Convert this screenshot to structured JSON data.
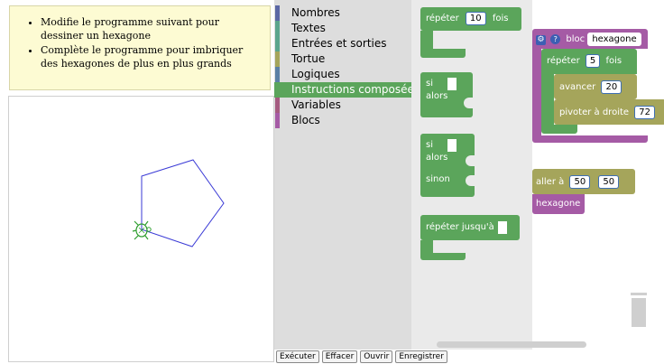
{
  "instructions": {
    "items": [
      "Modifie le programme suivant pour dessiner un hexagone",
      "Complète le programme pour imbriquer des hexagones de plus en plus grands"
    ]
  },
  "categories": [
    {
      "label": "Nombres",
      "color": "#5b67a5"
    },
    {
      "label": "Textes",
      "color": "#5ba58c"
    },
    {
      "label": "Entrées et sorties",
      "color": "#5ba58c"
    },
    {
      "label": "Tortue",
      "color": "#a5a55b"
    },
    {
      "label": "Logiques",
      "color": "#5b80a5"
    },
    {
      "label": "Instructions composées",
      "color": "#5ba55b",
      "selected": true
    },
    {
      "label": "Variables",
      "color": "#a55b80"
    },
    {
      "label": "Blocs",
      "color": "#a55ba5"
    }
  ],
  "flyout": {
    "repeat": {
      "label": "répéter",
      "count": "10",
      "suffix": "fois"
    },
    "if": {
      "si": "si",
      "alors": "alors"
    },
    "ifelse": {
      "si": "si",
      "alors": "alors",
      "sinon": "sinon"
    },
    "repeat_until": {
      "label": "répéter jusqu'à"
    }
  },
  "workspace": {
    "def_block": {
      "prefix": "bloc",
      "name": "hexagone"
    },
    "repeat": {
      "label": "répéter",
      "count": "5",
      "suffix": "fois"
    },
    "forward": {
      "label": "avancer",
      "value": "20"
    },
    "turn": {
      "label": "pivoter à droite",
      "value": "72"
    },
    "goto": {
      "label": "aller à",
      "x": "50",
      "y": "50"
    },
    "call": {
      "label": "hexagone"
    }
  },
  "buttons": {
    "run": "Exécuter",
    "clear": "Effacer",
    "open": "Ouvrir",
    "save": "Enregistrer"
  },
  "colors": {
    "loops": "#5ba55b",
    "turtle": "#a5a55b",
    "procedures": "#a55ba5",
    "pentagon": "#3a3ad6",
    "turtle_sprite": "#2e9e2e"
  }
}
